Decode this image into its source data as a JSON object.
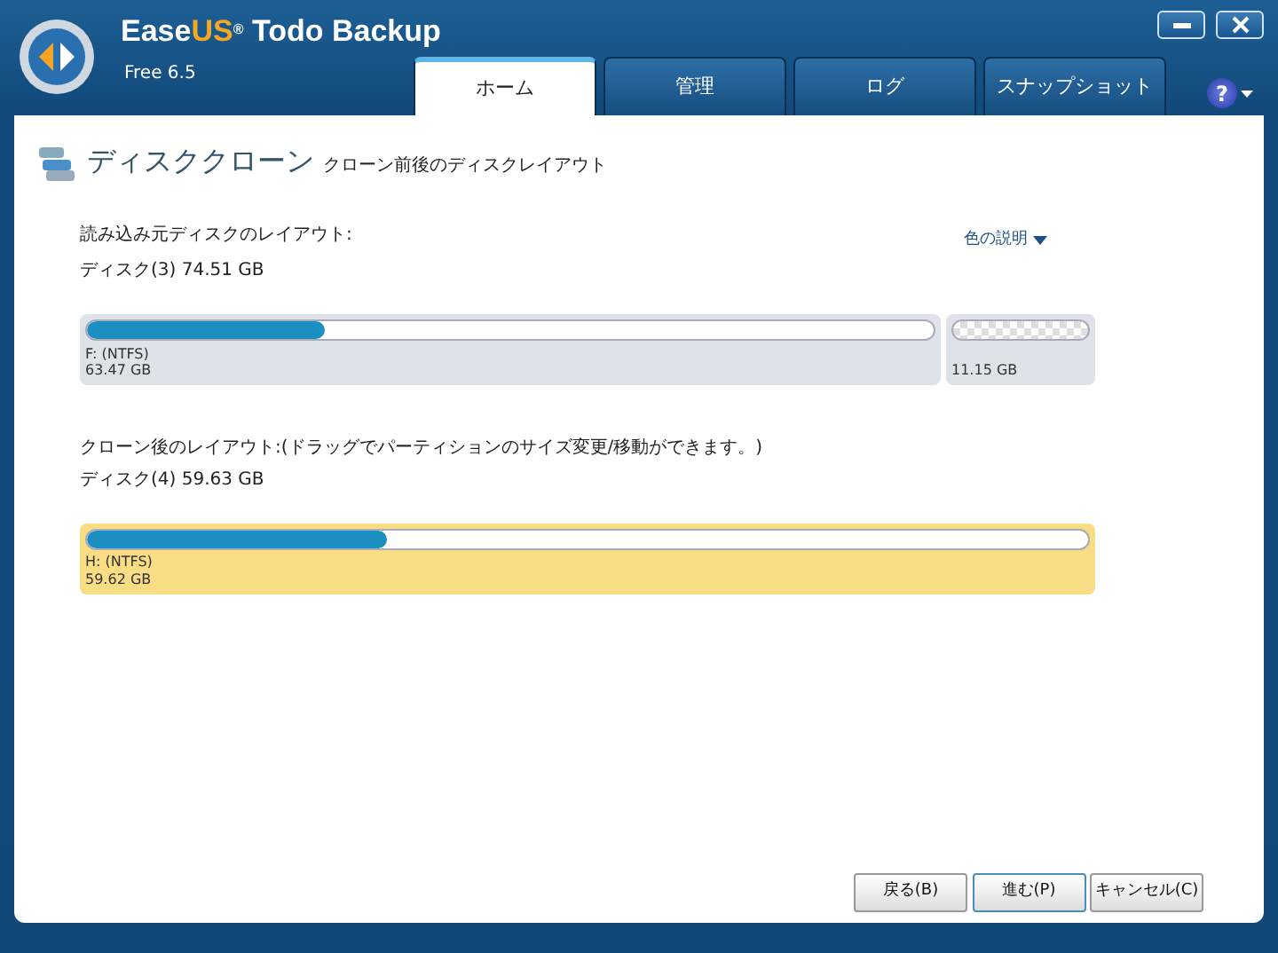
{
  "window": {
    "title_start": "Ease",
    "title_accent": "US",
    "title_mark": "®",
    "title_end": " Todo Backup",
    "edition": "Free 6.5"
  },
  "tabs": [
    {
      "label": "ホーム",
      "selected": true
    },
    {
      "label": "管理",
      "selected": false
    },
    {
      "label": "ログ",
      "selected": false
    },
    {
      "label": "スナップショット",
      "selected": false
    }
  ],
  "help": {
    "label": "?"
  },
  "page": {
    "title": "ディスククローン",
    "subtitle": "クローン前後のディスクレイアウト"
  },
  "source": {
    "heading": "読み込み元ディスクのレイアウト:",
    "disk": "ディスク(3) 74.51 GB",
    "legend": "色の説明",
    "partitions": [
      {
        "kind": "partition",
        "name": "F:  (NTFS)",
        "size": "63.47 GB",
        "level": 0.28
      },
      {
        "kind": "unallocated",
        "size": "11.15 GB"
      }
    ]
  },
  "target": {
    "heading": "クローン後のレイアウト:(ドラッグでパーティションのサイズ変更/移動ができます。)",
    "disk": "ディスク(4) 59.63 GB",
    "partitions": [
      {
        "kind": "partition",
        "name": "H:  (NTFS)",
        "size": "59.62 GB",
        "level": 0.3
      }
    ]
  },
  "buttons": [
    {
      "label": "戻る(B)",
      "default": false
    },
    {
      "label": "進む(P)",
      "default": true
    },
    {
      "label": "キャンセル(C)",
      "default": false
    }
  ]
}
